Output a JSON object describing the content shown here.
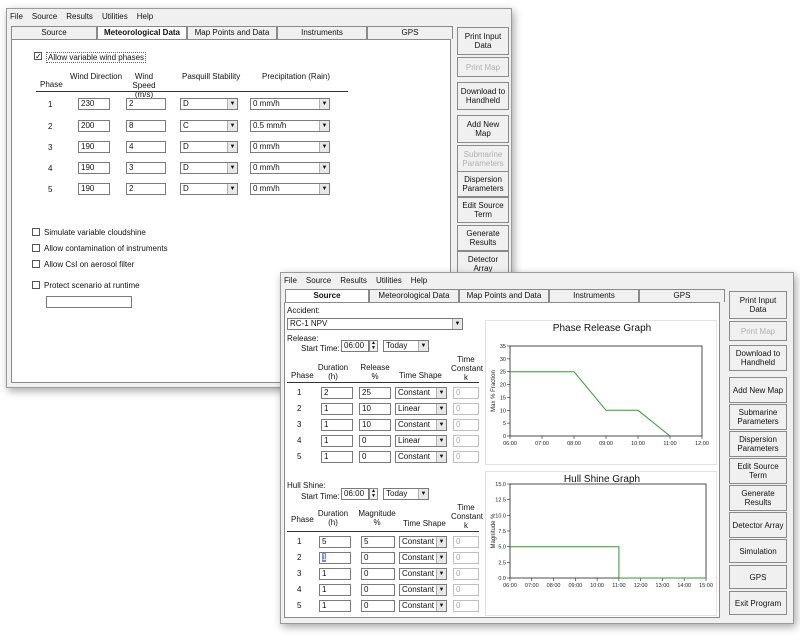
{
  "back": {
    "menu": [
      "File",
      "Source",
      "Results",
      "Utilities",
      "Help"
    ],
    "tabs": [
      "Source",
      "Meteorological Data",
      "Map Points and Data",
      "Instruments",
      "GPS"
    ],
    "allow_variable": "Allow variable wind phases",
    "headers": {
      "phase": "Phase",
      "wind_dir": "Wind Direction",
      "wind_speed": "Wind Speed (m/s)",
      "pasquill": "Pasquill Stability",
      "precip": "Precipitation (Rain)"
    },
    "rows": [
      {
        "phase": "1",
        "dir": "230",
        "speed": "2",
        "stab": "D",
        "precip": "0 mm/h"
      },
      {
        "phase": "2",
        "dir": "200",
        "speed": "8",
        "stab": "C",
        "precip": "0.5 mm/h"
      },
      {
        "phase": "3",
        "dir": "190",
        "speed": "4",
        "stab": "D",
        "precip": "0 mm/h"
      },
      {
        "phase": "4",
        "dir": "190",
        "speed": "3",
        "stab": "D",
        "precip": "0 mm/h"
      },
      {
        "phase": "5",
        "dir": "190",
        "speed": "2",
        "stab": "D",
        "precip": "0 mm/h"
      }
    ],
    "options": [
      "Simulate variable cloudshine",
      "Allow contamination of instruments",
      "Allow CsI on aerosol filter",
      "Protect scenario at runtime"
    ],
    "buttons": [
      "Print Input Data",
      "Print Map",
      "Download to Handheld",
      "Add New Map",
      "Submarine Parameters",
      "Dispersion Parameters",
      "Edit Source Term",
      "Generate Results",
      "Detector Array"
    ]
  },
  "front": {
    "menu": [
      "File",
      "Source",
      "Results",
      "Utilities",
      "Help"
    ],
    "tabs": [
      "Source",
      "Meteorological Data",
      "Map Points and Data",
      "Instruments",
      "GPS"
    ],
    "accident_label": "Accident:",
    "accident_value": "RC-1 NPV",
    "release_label": "Release:",
    "start_time_label": "Start Time:",
    "release_time": "06:00",
    "release_day": "Today",
    "release_headers": {
      "phase": "Phase",
      "duration": "Duration (h)",
      "release": "Release %",
      "shape": "Time Shape",
      "k": "Time Constant k"
    },
    "release_rows": [
      {
        "phase": "1",
        "duration": "2",
        "release": "25",
        "shape": "Constant",
        "k": "0"
      },
      {
        "phase": "2",
        "duration": "1",
        "release": "10",
        "shape": "Linear",
        "k": "0"
      },
      {
        "phase": "3",
        "duration": "1",
        "release": "10",
        "shape": "Constant",
        "k": "0"
      },
      {
        "phase": "4",
        "duration": "1",
        "release": "0",
        "shape": "Linear",
        "k": "0"
      },
      {
        "phase": "5",
        "duration": "1",
        "release": "0",
        "shape": "Constant",
        "k": "0"
      }
    ],
    "hull_label": "Hull Shine:",
    "hull_start_label": "Start Time:",
    "hull_time": "06:00",
    "hull_day": "Today",
    "hull_headers": {
      "phase": "Phase",
      "duration": "Duration (h)",
      "magnitude": "Magnitude %",
      "shape": "Time Shape",
      "k": "Time Constant k"
    },
    "hull_rows": [
      {
        "phase": "1",
        "duration": "5",
        "magnitude": "5",
        "shape": "Constant",
        "k": "0"
      },
      {
        "phase": "2",
        "duration": "1",
        "magnitude": "0",
        "shape": "Constant",
        "k": "0"
      },
      {
        "phase": "3",
        "duration": "1",
        "magnitude": "0",
        "shape": "Constant",
        "k": "0"
      },
      {
        "phase": "4",
        "duration": "1",
        "magnitude": "0",
        "shape": "Constant",
        "k": "0"
      },
      {
        "phase": "5",
        "duration": "1",
        "magnitude": "0",
        "shape": "Constant",
        "k": "0"
      }
    ],
    "buttons": [
      "Print Input Data",
      "Print Map",
      "Download to Handheld",
      "Add New Map",
      "Submarine Parameters",
      "Dispersion Parameters",
      "Edit Source Term",
      "Generate Results",
      "Detector Array",
      "Simulation",
      "GPS",
      "Exit Program"
    ]
  },
  "chart_data": [
    {
      "type": "line",
      "title": "Phase Release Graph",
      "ylabel": "Max % Fraction",
      "xlabel": "",
      "x_ticks": [
        "06:00",
        "07:00",
        "08:00",
        "09:00",
        "10:00",
        "11:00",
        "12:00"
      ],
      "y_ticks": [
        "0",
        "5",
        "10",
        "15",
        "20",
        "25",
        "30",
        "35"
      ],
      "xlim": [
        "06:00",
        "12:00"
      ],
      "ylim": [
        0,
        35
      ],
      "series": [
        {
          "color": "#2e9a2e",
          "x": [
            "06:00",
            "08:00",
            "09:00",
            "10:00",
            "10:30",
            "11:00"
          ],
          "y": [
            25,
            25,
            10,
            10,
            5,
            0
          ]
        }
      ]
    },
    {
      "type": "line",
      "title": "Hull Shine Graph",
      "ylabel": "Magnitude %",
      "xlabel": "",
      "x_ticks": [
        "06:00",
        "07:00",
        "08:00",
        "09:00",
        "10:00",
        "11:00",
        "12:00",
        "13:00",
        "14:00",
        "15:00"
      ],
      "y_ticks": [
        "0.0",
        "2.5",
        "5.0",
        "7.5",
        "10.0",
        "12.5",
        "15.0"
      ],
      "xlim": [
        "06:00",
        "15:00"
      ],
      "ylim": [
        0,
        15
      ],
      "series": [
        {
          "color": "#2e9a2e",
          "x": [
            "06:00",
            "11:00",
            "11:00",
            "15:00"
          ],
          "y": [
            5,
            5,
            0,
            0
          ]
        }
      ]
    }
  ]
}
